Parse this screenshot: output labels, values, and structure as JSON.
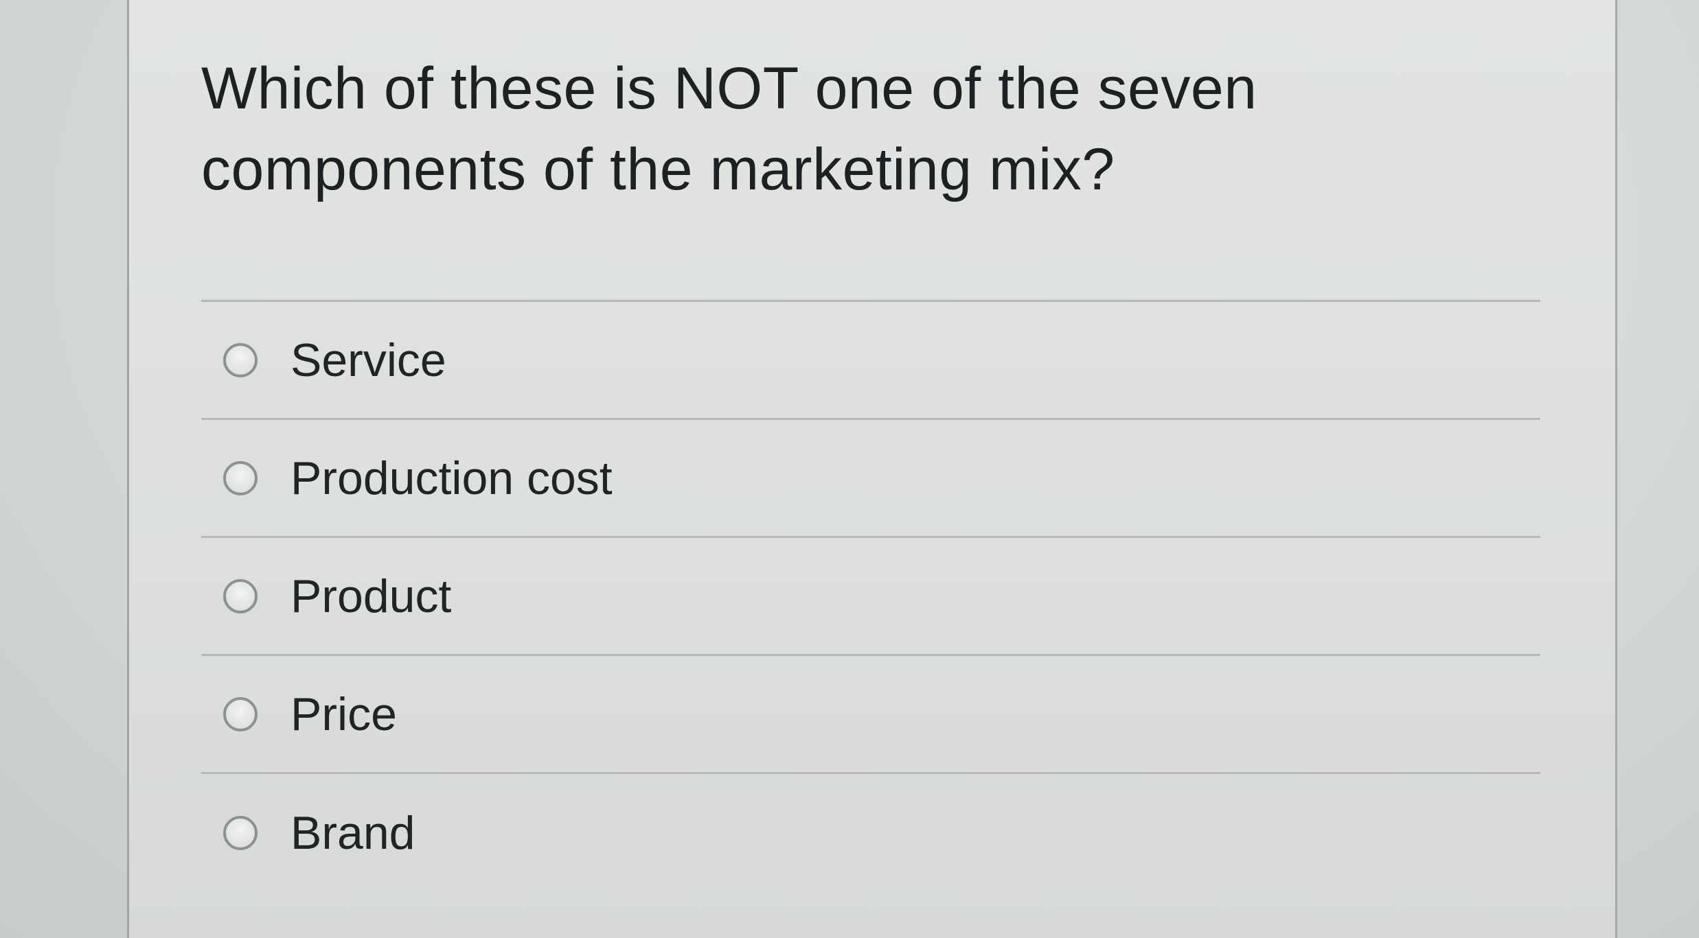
{
  "question": {
    "text": "Which of these is NOT one of the seven components of the marketing mix?"
  },
  "options": [
    {
      "label": "Service",
      "selected": false
    },
    {
      "label": "Production cost",
      "selected": false
    },
    {
      "label": "Product",
      "selected": false
    },
    {
      "label": "Price",
      "selected": false
    },
    {
      "label": "Brand",
      "selected": false
    }
  ],
  "colors": {
    "card_background": "#dfe2e0",
    "text": "#1d2124",
    "divider": "#b5bab8",
    "radio_border": "#8c9290"
  }
}
